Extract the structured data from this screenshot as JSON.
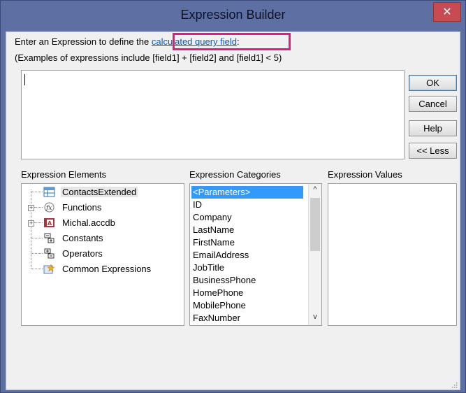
{
  "window": {
    "title": "Expression Builder",
    "close_glyph": "✕"
  },
  "instructions": {
    "line1_prefix": "Enter an Expression to define the ",
    "line1_link": "calculated query field",
    "line1_suffix": ":",
    "line2": "(Examples of expressions include [field1] + [field2] and [field1] < 5)"
  },
  "editor": {
    "value": ""
  },
  "buttons": {
    "ok": "OK",
    "cancel": "Cancel",
    "help": "Help",
    "less": "<< Less"
  },
  "elements": {
    "label": "Expression Elements",
    "items": [
      {
        "label": "ContactsExtended",
        "icon": "query-icon",
        "expandable": false
      },
      {
        "label": "Functions",
        "icon": "function-icon",
        "expandable": true
      },
      {
        "label": "Michal.accdb",
        "icon": "database-icon",
        "expandable": true
      },
      {
        "label": "Constants",
        "icon": "constants-icon",
        "expandable": false
      },
      {
        "label": "Operators",
        "icon": "operators-icon",
        "expandable": false
      },
      {
        "label": "Common Expressions",
        "icon": "common-expressions-icon",
        "expandable": false
      }
    ]
  },
  "categories": {
    "label": "Expression Categories",
    "items": [
      "<Parameters>",
      "ID",
      "Company",
      "LastName",
      "FirstName",
      "EmailAddress",
      "JobTitle",
      "BusinessPhone",
      "HomePhone",
      "MobilePhone",
      "FaxNumber"
    ],
    "selected": "<Parameters>"
  },
  "values": {
    "label": "Expression Values",
    "items": []
  },
  "colors": {
    "titlebar": "#5d6fa3",
    "highlight": "#e6197c",
    "link": "#0a57c2",
    "selection": "#3399ff",
    "close": "#c74b50"
  }
}
